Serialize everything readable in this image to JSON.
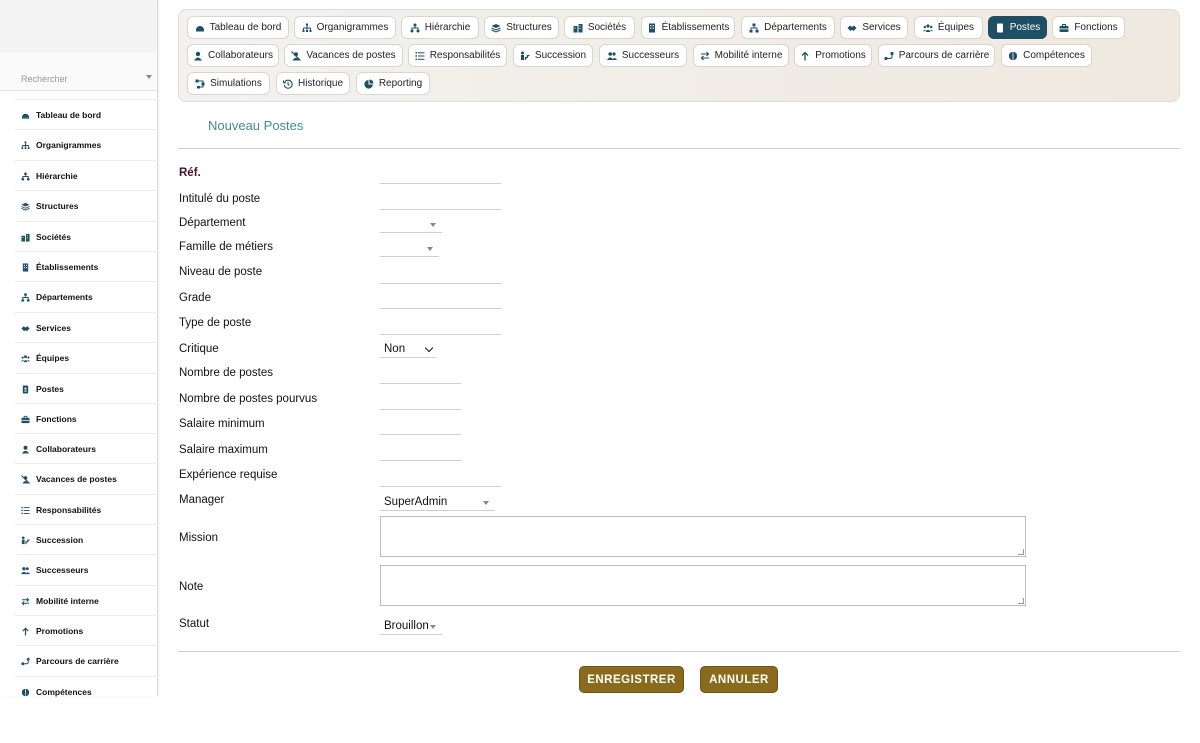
{
  "colors": {
    "accent": "#1f4f64",
    "brand_button": "#8a6a1c",
    "heading": "#3f8d8e",
    "ref_label": "#4a0f2a"
  },
  "sidebar": {
    "search_placeholder": "Rechercher",
    "items": [
      {
        "label": "Tableau de bord",
        "icon": "dashboard-icon"
      },
      {
        "label": "Organigrammes",
        "icon": "org-chart-icon"
      },
      {
        "label": "Hiérarchie",
        "icon": "hierarchy-icon"
      },
      {
        "label": "Structures",
        "icon": "layers-icon"
      },
      {
        "label": "Sociétés",
        "icon": "buildings-icon"
      },
      {
        "label": "Établissements",
        "icon": "building-icon"
      },
      {
        "label": "Départements",
        "icon": "sitemap-icon"
      },
      {
        "label": "Services",
        "icon": "handshake-icon"
      },
      {
        "label": "Équipes",
        "icon": "team-icon"
      },
      {
        "label": "Postes",
        "icon": "id-badge-icon"
      },
      {
        "label": "Fonctions",
        "icon": "briefcase-icon"
      },
      {
        "label": "Collaborateurs",
        "icon": "user-icon"
      },
      {
        "label": "Vacances de postes",
        "icon": "user-slash-icon"
      },
      {
        "label": "Responsabilités",
        "icon": "list-icon"
      },
      {
        "label": "Succession",
        "icon": "succession-icon"
      },
      {
        "label": "Successeurs",
        "icon": "users-icon"
      },
      {
        "label": "Mobilité interne",
        "icon": "exchange-icon"
      },
      {
        "label": "Promotions",
        "icon": "arrow-up-icon"
      },
      {
        "label": "Parcours de carrière",
        "icon": "route-icon"
      },
      {
        "label": "Compétences",
        "icon": "brain-icon"
      }
    ]
  },
  "topnav": {
    "tabs": [
      {
        "label": "Tableau de bord",
        "icon": "dashboard-icon"
      },
      {
        "label": "Organigrammes",
        "icon": "org-chart-icon"
      },
      {
        "label": "Hiérarchie",
        "icon": "hierarchy-icon"
      },
      {
        "label": "Structures",
        "icon": "layers-icon"
      },
      {
        "label": "Sociétés",
        "icon": "buildings-icon"
      },
      {
        "label": "Établissements",
        "icon": "building-icon"
      },
      {
        "label": "Départements",
        "icon": "sitemap-icon"
      },
      {
        "label": "Services",
        "icon": "handshake-icon"
      },
      {
        "label": "Équipes",
        "icon": "team-icon"
      },
      {
        "label": "Postes",
        "icon": "id-badge-icon",
        "active": true
      },
      {
        "label": "Fonctions",
        "icon": "briefcase-icon"
      },
      {
        "label": "Collaborateurs",
        "icon": "user-icon"
      },
      {
        "label": "Vacances de postes",
        "icon": "user-slash-icon"
      },
      {
        "label": "Responsabilités",
        "icon": "list-icon"
      },
      {
        "label": "Succession",
        "icon": "succession-icon"
      },
      {
        "label": "Successeurs",
        "icon": "users-icon"
      },
      {
        "label": "Mobilité interne",
        "icon": "exchange-icon"
      },
      {
        "label": "Promotions",
        "icon": "arrow-up-icon"
      },
      {
        "label": "Parcours de carrière",
        "icon": "route-icon"
      },
      {
        "label": "Compétences",
        "icon": "brain-icon"
      },
      {
        "label": "Simulations",
        "icon": "diagram-icon"
      },
      {
        "label": "Historique",
        "icon": "history-icon"
      },
      {
        "label": "Reporting",
        "icon": "pie-chart-icon"
      }
    ]
  },
  "page": {
    "title": "Nouveau Postes"
  },
  "form": {
    "ref_label": "Réf.",
    "intitule_label": "Intitulé du poste",
    "departement_label": "Département",
    "famille_label": "Famille de métiers",
    "niveau_label": "Niveau de poste",
    "grade_label": "Grade",
    "type_label": "Type de poste",
    "critique_label": "Critique",
    "critique_value": "Non",
    "nombre_label": "Nombre de postes",
    "pourvus_label": "Nombre de postes pourvus",
    "salaire_min_label": "Salaire minimum",
    "salaire_max_label": "Salaire maximum",
    "experience_label": "Expérience requise",
    "manager_label": "Manager",
    "manager_value": "SuperAdmin",
    "mission_label": "Mission",
    "note_label": "Note",
    "statut_label": "Statut",
    "statut_value": "Brouillon"
  },
  "actions": {
    "save_label": "ENREGISTRER",
    "cancel_label": "ANNULER"
  }
}
